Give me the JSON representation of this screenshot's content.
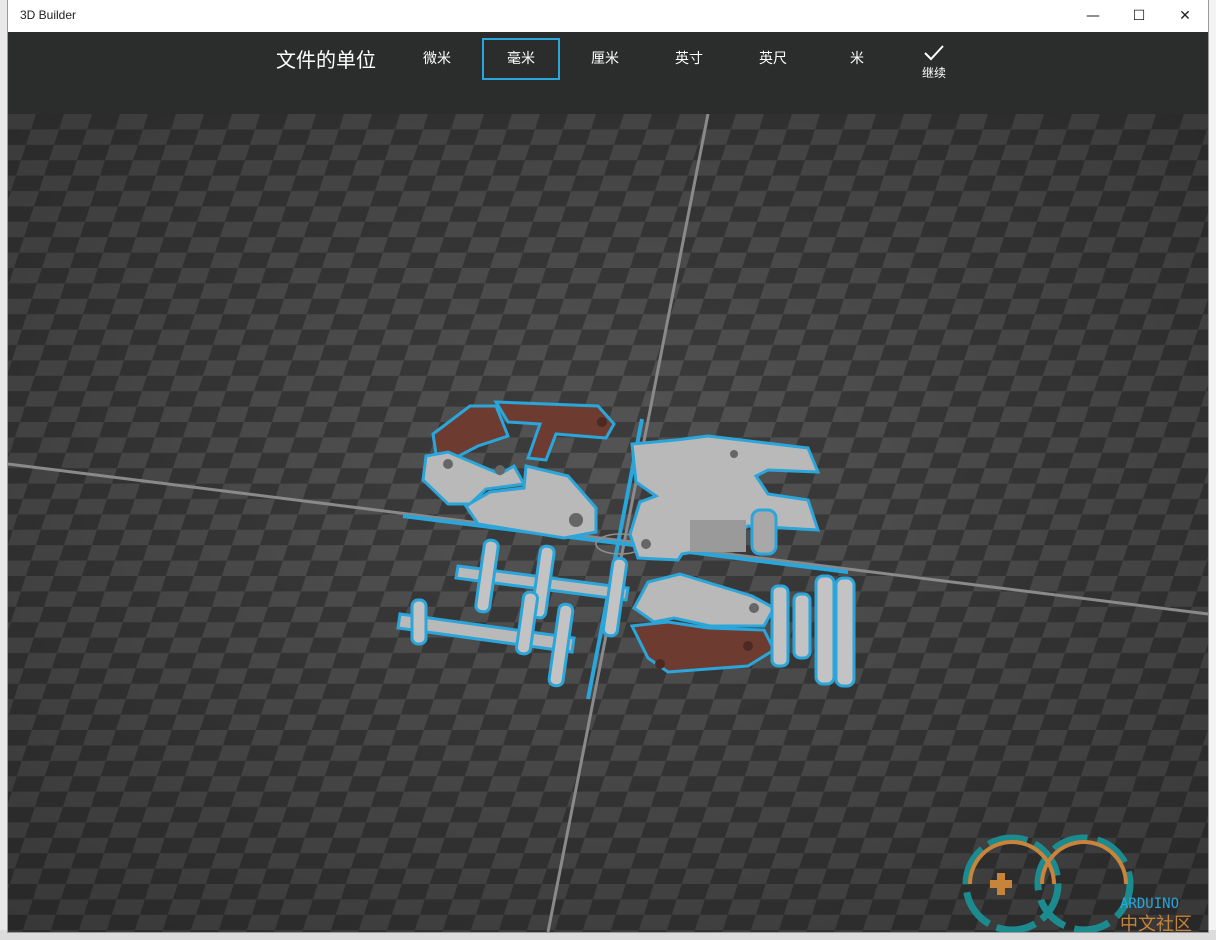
{
  "window": {
    "title": "3D Builder",
    "controls": {
      "minimize": "—",
      "maximize": "☐",
      "close": "✕"
    }
  },
  "toolbar": {
    "units_label": "文件的单位",
    "units": [
      {
        "label": "微米",
        "selected": false
      },
      {
        "label": "毫米",
        "selected": true
      },
      {
        "label": "厘米",
        "selected": false
      },
      {
        "label": "英寸",
        "selected": false
      },
      {
        "label": "英尺",
        "selected": false
      },
      {
        "label": "米",
        "selected": false
      }
    ],
    "continue_label": "继续"
  },
  "colors": {
    "accent": "#2aa6db",
    "toolbar_bg": "#2b2c2c",
    "part_gray": "#b9b9b9",
    "part_brown": "#6e3b30"
  },
  "watermark": {
    "brand": "ARDUINO",
    "subtitle": "中文社区"
  }
}
